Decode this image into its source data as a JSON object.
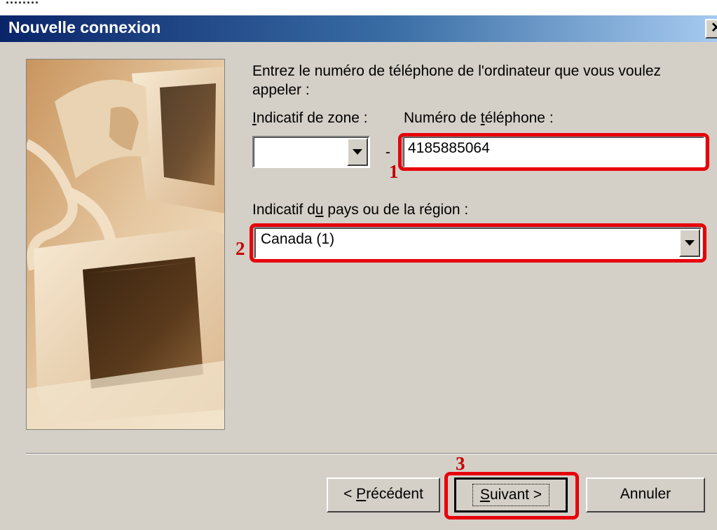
{
  "window": {
    "title": "Nouvelle connexion",
    "close_glyph": "✕",
    "close_icon": "close-icon"
  },
  "form": {
    "instruction": "Entrez le numéro de téléphone de l'ordinateur que vous voulez appeler :",
    "area_code_label_prefix": "",
    "area_code_label_u": "I",
    "area_code_label_rest": "ndicatif de zone :",
    "phone_label_prefix": "Numéro de ",
    "phone_label_u": "t",
    "phone_label_rest": "éléphone :",
    "area_code_value": "",
    "dash": "-",
    "phone_value": "4185885064",
    "country_label_prefix": "Indicatif d",
    "country_label_u": "u",
    "country_label_rest": " pays ou de la région :",
    "country_value": "Canada (1)"
  },
  "annotations": {
    "one": "1",
    "two": "2",
    "three": "3",
    "color": "#e8000a"
  },
  "buttons": {
    "back_u": "P",
    "back_prefix": "< ",
    "back_rest": "récédent",
    "next_u": "S",
    "next_rest": "uivant >",
    "cancel": "Annuler"
  },
  "colors": {
    "titlebar_start": "#0a246a",
    "titlebar_end": "#a6caf0",
    "dialog_bg": "#d4d0c8"
  }
}
